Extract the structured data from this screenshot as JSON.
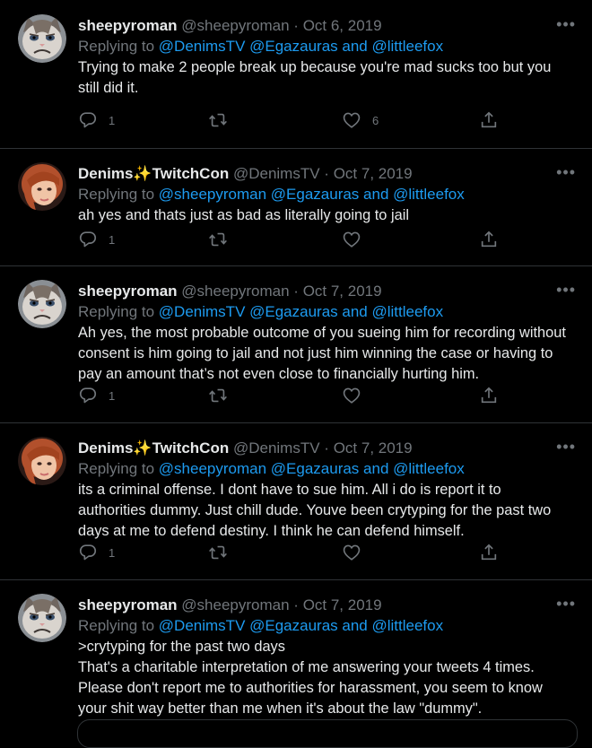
{
  "colors": {
    "background": "#000000",
    "text": "#e7e9ea",
    "muted": "#71767b",
    "link": "#1d9bf0",
    "divider": "#2f3336"
  },
  "tweets": [
    {
      "display_name": "sheepyroman",
      "display_suffix": "",
      "handle": "@sheepyroman",
      "separator": "·",
      "date": "Oct 6, 2019",
      "replying_prefix": "Replying to",
      "reply_handles": "@DenimsTV @Egazauras and @littleefox",
      "body": [
        "Trying to make 2 people break up because you're mad sucks too but you",
        "still did it."
      ],
      "reply_count": "1",
      "retweet_count": "",
      "like_count": "6",
      "avatar": "grumpy-cat-avatar"
    },
    {
      "display_name": "Denims",
      "display_suffix": "TwitchCon",
      "handle": "@DenimsTV",
      "separator": "·",
      "date": "Oct 7, 2019",
      "replying_prefix": "Replying to",
      "reply_handles": "@sheepyroman @Egazauras and @littleefox",
      "body": [
        "ah yes and thats just as bad as literally going to jail"
      ],
      "reply_count": "1",
      "retweet_count": "",
      "like_count": "",
      "avatar": "denims-avatar"
    },
    {
      "display_name": "sheepyroman",
      "display_suffix": "",
      "handle": "@sheepyroman",
      "separator": "·",
      "date": "Oct 7, 2019",
      "replying_prefix": "Replying to",
      "reply_handles": "@DenimsTV @Egazauras and @littleefox",
      "body": [
        "Ah yes, the most probable outcome of you sueing him for recording without",
        "consent is him going to jail and not just him winning the case or having to",
        "pay an amount that’s not even close to financially hurting him."
      ],
      "reply_count": "1",
      "retweet_count": "",
      "like_count": "",
      "avatar": "grumpy-cat-avatar"
    },
    {
      "display_name": "Denims",
      "display_suffix": "TwitchCon",
      "handle": "@DenimsTV",
      "separator": "·",
      "date": "Oct 7, 2019",
      "replying_prefix": "Replying to",
      "reply_handles": "@sheepyroman @Egazauras and @littleefox",
      "body": [
        "its a criminal offense. I dont have to sue him. All i do is report it to",
        "authorities dummy. Just chill dude. Youve been crytyping for the past two",
        "days at me to defend destiny. I think he can defend himself."
      ],
      "reply_count": "1",
      "retweet_count": "",
      "like_count": "",
      "avatar": "denims-avatar"
    },
    {
      "display_name": "sheepyroman",
      "display_suffix": "",
      "handle": "@sheepyroman",
      "separator": "·",
      "date": "Oct 7, 2019",
      "replying_prefix": "Replying to",
      "reply_handles": "@DenimsTV @Egazauras and @littleefox",
      "body": [
        ">crytyping for the past two days",
        "That's a charitable interpretation of me answering your tweets 4 times.",
        "Please don't report me to authorities for harassment, you seem to know",
        "your shit way better than me when it's about the law \"dummy\"."
      ],
      "reply_count": "",
      "retweet_count": "",
      "like_count": "",
      "avatar": "grumpy-cat-avatar"
    }
  ]
}
